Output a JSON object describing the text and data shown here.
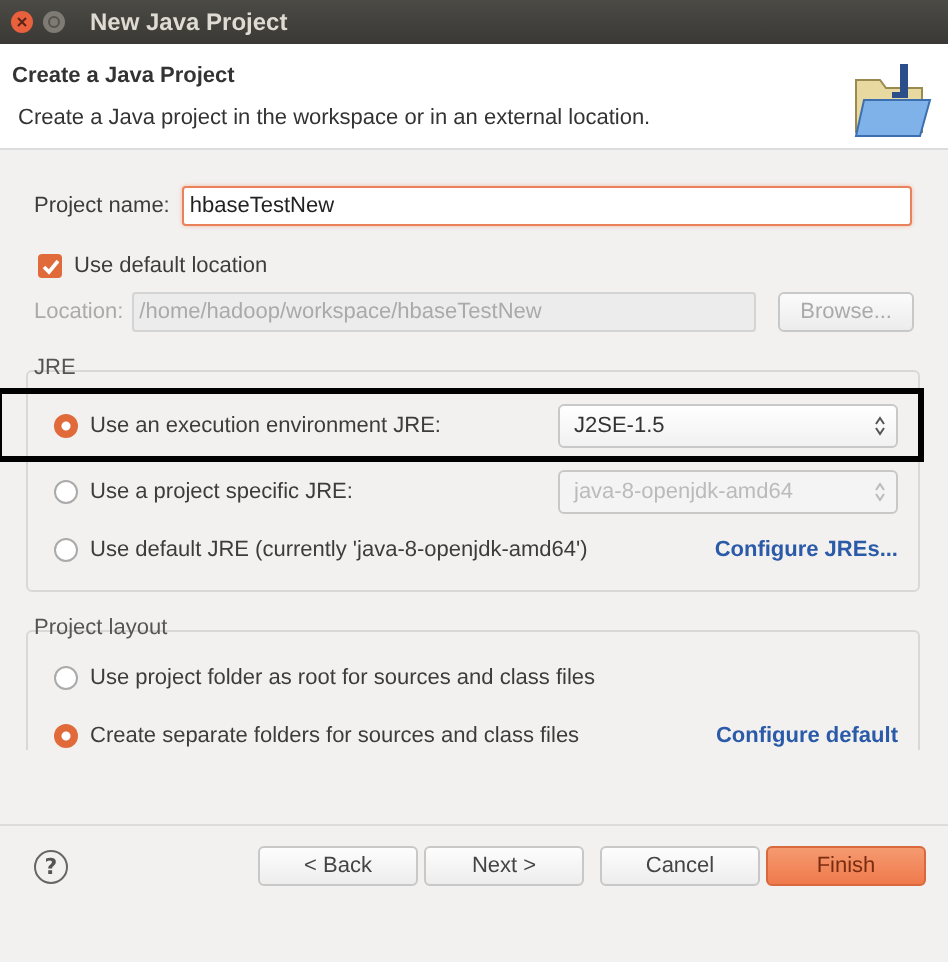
{
  "window": {
    "title": "New Java Project"
  },
  "header": {
    "title": "Create a Java Project",
    "description": "Create a Java project in the workspace or in an external location."
  },
  "project_name": {
    "label": "Project name:",
    "value": "hbaseTestNew"
  },
  "use_default_location": {
    "label": "Use default location",
    "checked": true
  },
  "location": {
    "label": "Location:",
    "value": "/home/hadoop/workspace/hbaseTestNew",
    "disabled": true,
    "button": "Browse..."
  },
  "jre": {
    "title": "JRE",
    "options": [
      {
        "kind": "dropdown",
        "label": "Use an execution environment JRE:",
        "selected": true,
        "highlighted": true,
        "value": "J2SE-1.5"
      },
      {
        "kind": "dropdown",
        "label": "Use a project specific JRE:",
        "selected": false,
        "highlighted": false,
        "value": "java-8-openjdk-amd64"
      },
      {
        "kind": "link",
        "label": "Use default JRE (currently 'java-8-openjdk-amd64')",
        "selected": false,
        "highlighted": false,
        "link": "Configure JREs..."
      }
    ]
  },
  "project_layout": {
    "title": "Project layout",
    "options": [
      {
        "kind": "plain",
        "label": "Use project folder as root for sources and class files",
        "selected": false
      },
      {
        "kind": "link",
        "label": "Create separate folders for sources and class files",
        "selected": true,
        "link": "Configure default"
      }
    ]
  },
  "help_button": "?",
  "buttons": [
    {
      "label": "< Back",
      "kind": "normal"
    },
    {
      "label": "Next >",
      "kind": "normal"
    },
    {
      "label": "Cancel",
      "kind": "normal"
    },
    {
      "label": "Finish",
      "kind": "default"
    }
  ]
}
